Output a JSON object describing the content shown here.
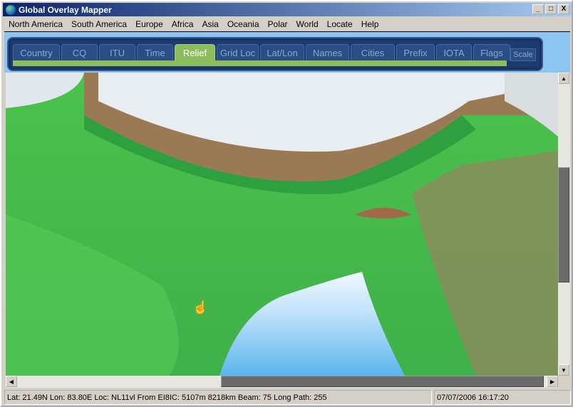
{
  "window": {
    "title": "Global Overlay Mapper",
    "minimize": "_",
    "maximize": "□",
    "close": "X"
  },
  "menu": [
    "North America",
    "South America",
    "Europe",
    "Africa",
    "Asia",
    "Oceania",
    "Polar",
    "World",
    "Locate",
    "Help"
  ],
  "tabs": [
    {
      "label": "Country",
      "w": 66
    },
    {
      "label": "CQ",
      "w": 51
    },
    {
      "label": "ITU",
      "w": 51
    },
    {
      "label": "Time",
      "w": 51
    },
    {
      "label": "Relief",
      "w": 57,
      "active": true
    },
    {
      "label": "Grid Loc",
      "w": 59
    },
    {
      "label": "Lat/Lon",
      "w": 62
    },
    {
      "label": "Names",
      "w": 61
    },
    {
      "label": "Cities",
      "w": 62
    },
    {
      "label": "Prefix",
      "w": 54
    },
    {
      "label": "IOTA",
      "w": 50
    },
    {
      "label": "Flags",
      "w": 52
    }
  ],
  "scale_label": "Scale",
  "status": {
    "info": "Lat: 21.49N  Lon: 83.80E  Loc: NL11vl  From EI8IC: 5107m  8218km  Beam: 75  Long Path: 255",
    "datetime": "07/07/2006 16:17:20"
  },
  "scroll": {
    "horizontal_position": 0.5,
    "vertical_position": 0.45
  }
}
